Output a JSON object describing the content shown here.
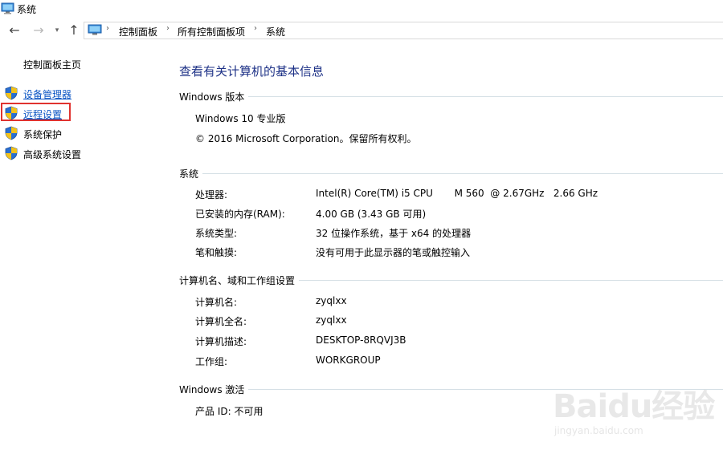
{
  "window": {
    "title": "系统"
  },
  "breadcrumb": [
    "控制面板",
    "所有控制面板项",
    "系统"
  ],
  "sidebar": {
    "home": "控制面板主页",
    "items": [
      {
        "label": "设备管理器",
        "icon": "uac-shield-icon"
      },
      {
        "label": "远程设置",
        "icon": "uac-shield-icon"
      },
      {
        "label": "系统保护",
        "icon": "uac-shield-icon"
      },
      {
        "label": "高级系统设置",
        "icon": "uac-shield-icon"
      }
    ]
  },
  "main": {
    "title": "查看有关计算机的基本信息",
    "windows_edition": {
      "heading": "Windows 版本",
      "edition": "Windows 10 专业版",
      "copyright": "© 2016 Microsoft Corporation。保留所有权利。"
    },
    "system": {
      "heading": "系统",
      "rows": [
        {
          "label": "处理器:",
          "value": "Intel(R) Core(TM) i5 CPU       M 560  @ 2.67GHz   2.66 GHz"
        },
        {
          "label": "已安装的内存(RAM):",
          "value": "4.00 GB (3.43 GB 可用)"
        },
        {
          "label": "系统类型:",
          "value": "32 位操作系统，基于 x64 的处理器"
        },
        {
          "label": "笔和触摸:",
          "value": "没有可用于此显示器的笔或触控输入"
        }
      ]
    },
    "computer": {
      "heading": "计算机名、域和工作组设置",
      "rows": [
        {
          "label": "计算机名:",
          "value": "zyqlxx"
        },
        {
          "label": "计算机全名:",
          "value": "zyqlxx"
        },
        {
          "label": "计算机描述:",
          "value": "DESKTOP-8RQVJ3B"
        },
        {
          "label": "工作组:",
          "value": "WORKGROUP"
        }
      ]
    },
    "activation": {
      "heading": "Windows 激活",
      "product_id": "产品 ID: 不可用"
    }
  },
  "watermark": {
    "text": "Baidu经验",
    "sub": "jingyan.baidu.com"
  },
  "colors": {
    "link": "#0b55c4",
    "title": "#1e3287",
    "highlight": "#e0322f",
    "divider": "#d5dfe5"
  }
}
